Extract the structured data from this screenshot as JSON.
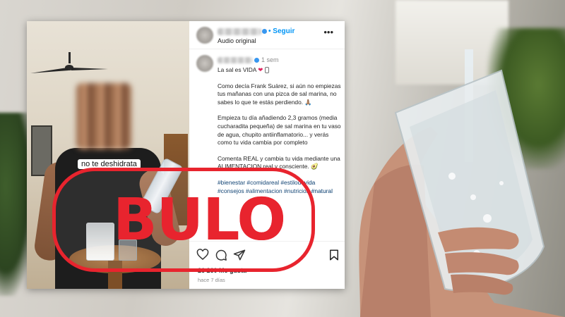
{
  "colors": {
    "accent_link": "#0095f6",
    "hashtag": "#00376b",
    "stamp_red": "#e8242e",
    "heart_red": "#e0245e"
  },
  "post": {
    "header": {
      "follow_label": "• Seguir",
      "audio_label": "Audio original",
      "more_icon": "more-horizontal-icon"
    },
    "comment": {
      "time": "1 sem",
      "title": "La sal es VIDA",
      "paragraphs": [
        "Como decía Frank Suárez, si aún no empiezas tus mañanas con una pizca de sal marina, no sabes lo que te estás perdiendo. 🙏🏽",
        "Empieza tu día añadiendo 2,3 gramos (media cucharadita pequeña) de sal marina en tu vaso de agua, chupito antiinflamatorio... y verás como tu vida cambia por completo",
        "Comenta REAL y cambia tu vida mediante una ALIMENTACION real y consciente. 🥑"
      ],
      "hashtags": "#bienestar #comidareal #estilodevida #consejos #alimentacion #nutricion #natural"
    },
    "video_overlay_text": "no te deshidrata",
    "actions": {
      "icons": [
        "heart-icon",
        "comment-icon",
        "share-icon",
        "bookmark-icon"
      ],
      "likes": "26 260 Me gusta",
      "date": "hace 7 días"
    }
  },
  "stamp": {
    "word": "BULO"
  }
}
